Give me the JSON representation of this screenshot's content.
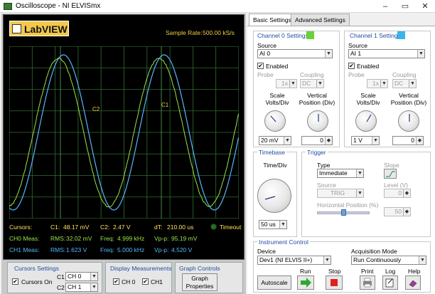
{
  "window": {
    "title": "Oscilloscope - NI ELVISmx",
    "minimize": "–",
    "maximize": "▭",
    "close": "✕"
  },
  "logo": {
    "text": "LabVIEW"
  },
  "sample_rate": {
    "label": "Sample Rate:",
    "value": "500.00 kS/s"
  },
  "plot": {
    "c1_label": "C1",
    "c2_label": "C2",
    "ch0_color": "#9be34a",
    "ch1_color": "#54b8ff"
  },
  "readout": {
    "cursors": {
      "label": "Cursors:",
      "c1_label": "C1:",
      "c1_value": "48.17 mV",
      "c2_label": "C2:",
      "c2_value": "2.47 V",
      "dt_label": "dT:",
      "dt_value": "210.00 us",
      "timeout": "Timeout"
    },
    "ch0": {
      "label": "CH0 Meas:",
      "rms_label": "RMS:",
      "rms": "32.02 mV",
      "freq_label": "Freq:",
      "freq": "4.999 kHz",
      "vpp_label": "Vp-p:",
      "vpp": "95.19 mV"
    },
    "ch1": {
      "label": "CH1 Meas:",
      "rms_label": "RMS:",
      "rms": "1.623 V",
      "freq_label": "Freq:",
      "freq": "5.000 kHz",
      "vpp_label": "Vp-p:",
      "vpp": "4.520 V"
    }
  },
  "cursor_settings": {
    "title": "Cursors Settings",
    "cursors_on": "Cursors On",
    "c1": "C1",
    "c1_val": "CH 0",
    "c2": "C2",
    "c2_val": "CH 1"
  },
  "display_meas": {
    "title": "Display Measurements",
    "ch0": "CH 0",
    "ch1": "CH1"
  },
  "graph_controls": {
    "title": "Graph Controls",
    "button": "Graph Properties"
  },
  "tabs": [
    "Basic Settings",
    "Advanced Settings"
  ],
  "channel0": {
    "title": "Channel 0 Settings",
    "color": "#6bd13a",
    "source_label": "Source",
    "source": "AI 0",
    "enabled": "Enabled",
    "probe_label": "Probe",
    "probe": "1x",
    "coupling_label": "Coupling",
    "coupling": "DC",
    "scale_label": "Scale Volts/Div",
    "scale": "20 mV",
    "vpos_label": "Vertical Position (Div)",
    "vpos": "0"
  },
  "channel1": {
    "title": "Channel 1 Settings",
    "color": "#3ab4e8",
    "source_label": "Source",
    "source": "AI 1",
    "enabled": "Enabled",
    "probe_label": "Probe",
    "probe": "1x",
    "coupling_label": "Coupling",
    "coupling": "DC",
    "scale_label": "Scale Volts/Div",
    "scale": "1 V",
    "vpos_label": "Vertical Position (Div)",
    "vpos": "0"
  },
  "timebase": {
    "title": "Timebase",
    "label": "Time/Div",
    "value": "50 us"
  },
  "trigger": {
    "title": "Trigger",
    "type_label": "Type",
    "type": "Immediate",
    "slope_label": "Slope",
    "source_label": "Source",
    "source": "TRIG",
    "level_label": "Level (V)",
    "level": "0",
    "hpos_label": "Horizontal Position (%)",
    "hpos": "50"
  },
  "instrument": {
    "title": "Instrument Control",
    "device_label": "Device",
    "device": "Dev1 (NI ELVIS II+)",
    "acq_label": "Acquisition Mode",
    "acq": "Run Continuously",
    "autoscale": "Autoscale",
    "run": "Run",
    "stop": "Stop",
    "print": "Print",
    "log": "Log",
    "help": "Help"
  },
  "icons": {
    "run": "run-arrow-icon",
    "stop": "stop-square-icon",
    "print": "printer-icon",
    "log": "log-icon",
    "help": "help-book-icon",
    "checked": "✔"
  }
}
